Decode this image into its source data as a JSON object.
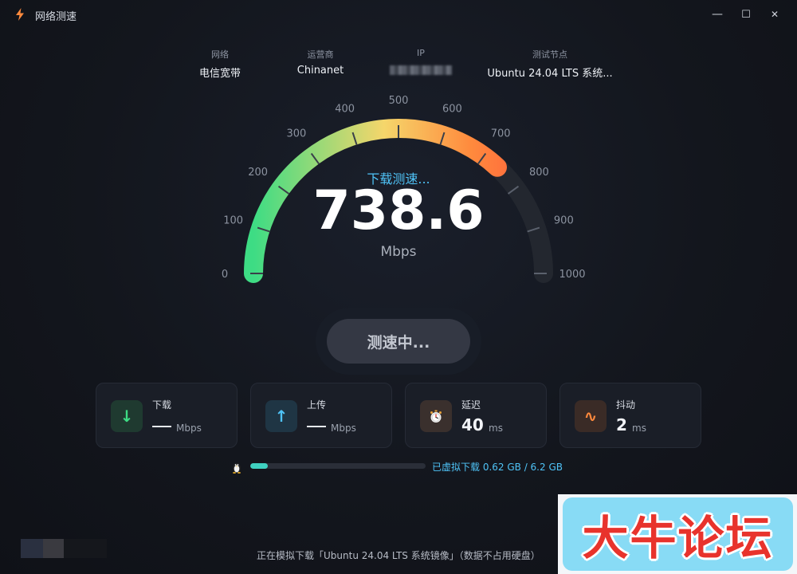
{
  "window": {
    "title": "网络测速",
    "minimize_glyph": "—",
    "maximize_glyph": "☐",
    "close_glyph": "✕"
  },
  "info": {
    "network_label": "网络",
    "network_value": "电信宽带",
    "isp_label": "运营商",
    "isp_value": "Chinanet",
    "ip_label": "IP",
    "node_label": "测试节点",
    "node_value": "Ubuntu 24.04 LTS 系统..."
  },
  "gauge": {
    "status": "下载测速...",
    "speed": "738.6",
    "unit": "Mbps",
    "max": 1000,
    "ticks": [
      "0",
      "100",
      "200",
      "300",
      "400",
      "500",
      "600",
      "700",
      "800",
      "900",
      "1000"
    ],
    "arc_colors": [
      "#3ddc84",
      "#f5d66b",
      "#ff8a3d",
      "#ff5a3c"
    ],
    "track_color": "#23272f"
  },
  "action": {
    "button_label": "测速中..."
  },
  "cards": {
    "download": {
      "label": "下载",
      "unit": "Mbps",
      "icon": "arrow-down-icon",
      "color": "#3ddc84"
    },
    "upload": {
      "label": "上传",
      "unit": "Mbps",
      "icon": "arrow-up-icon",
      "color": "#4fc3f7"
    },
    "latency": {
      "label": "延迟",
      "value": "40",
      "unit": "ms",
      "icon": "stopwatch-icon"
    },
    "jitter": {
      "label": "抖动",
      "value": "2",
      "unit": "ms",
      "icon": "wave-icon",
      "color": "#ff8a3d"
    }
  },
  "progress": {
    "fraction": 0.1,
    "text": "已虚拟下载 0.62 GB / 6.2 GB",
    "color": "#3fd1c0"
  },
  "status_line": "正在模拟下载「Ubuntu 24.04 LTS 系统镜像」（数据不占用硬盘）",
  "watermark": {
    "text": "大牛论坛"
  }
}
